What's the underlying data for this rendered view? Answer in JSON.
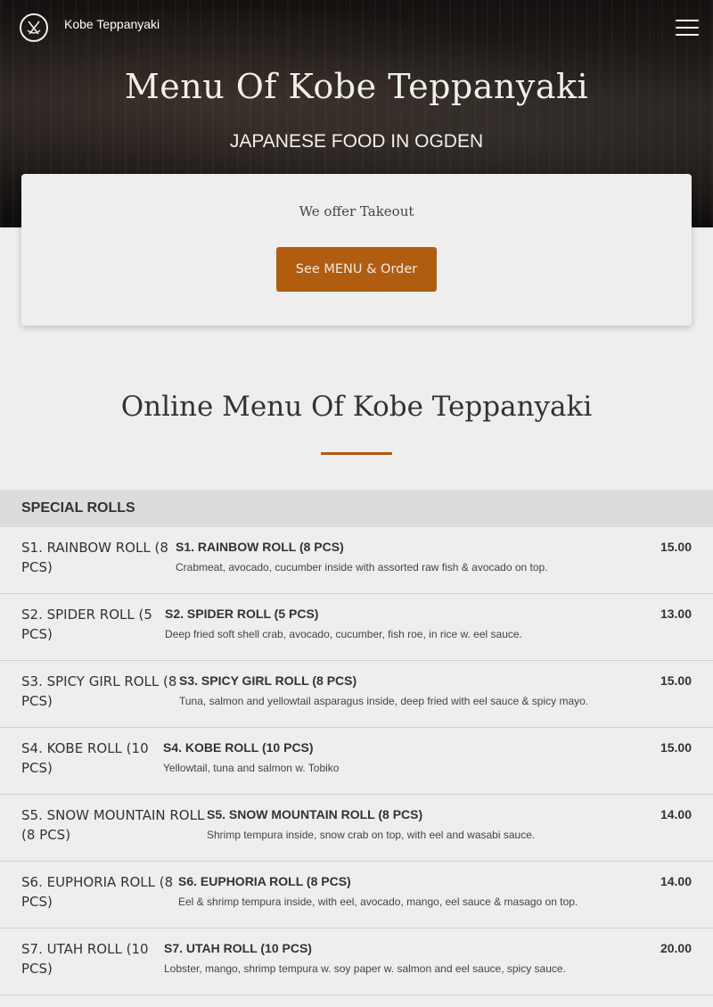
{
  "nav": {
    "brand": "Kobe Teppanyaki",
    "logo_icon": "chopsticks-plate-icon",
    "menu_icon": "hamburger-menu-icon"
  },
  "hero": {
    "title": "Menu Of Kobe Teppanyaki",
    "subtitle": "JAPANESE FOOD IN OGDEN"
  },
  "takeout_card": {
    "text": "We offer Takeout",
    "button_label": "See MENU & Order"
  },
  "menu_section": {
    "title": "Online Menu Of Kobe Teppanyaki",
    "category": "SPECIAL ROLLS",
    "items": [
      {
        "img_alt": "S1. RAINBOW ROLL (8 PCS)",
        "name": "S1. RAINBOW ROLL (8 PCS)",
        "desc": "Crabmeat, avocado, cucumber inside with assorted raw fish & avocado on top.",
        "price": "15.00"
      },
      {
        "img_alt": "S2. SPIDER ROLL (5 PCS)",
        "name": "S2. SPIDER ROLL (5 PCS)",
        "desc": "Deep fried soft shell crab, avocado, cucumber, fish roe, in rice w. eel sauce.",
        "price": "13.00"
      },
      {
        "img_alt": "S3. SPICY GIRL ROLL (8 PCS)",
        "name": "S3. SPICY GIRL ROLL (8 PCS)",
        "desc": "Tuna, salmon and yellowtail asparagus inside, deep fried with eel sauce & spicy mayo.",
        "price": "15.00"
      },
      {
        "img_alt": "S4. KOBE ROLL (10 PCS)",
        "name": "S4. KOBE ROLL (10 PCS)",
        "desc": "Yellowtail, tuna and salmon w. Tobiko",
        "price": "15.00"
      },
      {
        "img_alt": "S5. SNOW MOUNTAIN ROLL (8 PCS)",
        "name": "S5. SNOW MOUNTAIN ROLL (8 PCS)",
        "desc": "Shrimp tempura inside, snow crab on top, with eel and wasabi sauce.",
        "price": "14.00"
      },
      {
        "img_alt": "S6. EUPHORIA ROLL (8 PCS)",
        "name": "S6. EUPHORIA ROLL (8 PCS)",
        "desc": "Eel & shrimp tempura inside, with eel, avocado, mango, eel sauce & masago on top.",
        "price": "14.00"
      },
      {
        "img_alt": "S7. UTAH ROLL (10 PCS)",
        "name": "S7. UTAH ROLL (10 PCS)",
        "desc": "Lobster, mango, shrimp tempura w. soy paper w. salmon and eel sauce, spicy sauce.",
        "price": "20.00"
      }
    ]
  },
  "colors": {
    "accent": "#b05d12",
    "page_bg": "#eeeeee",
    "category_bg": "#dcdcdc"
  }
}
